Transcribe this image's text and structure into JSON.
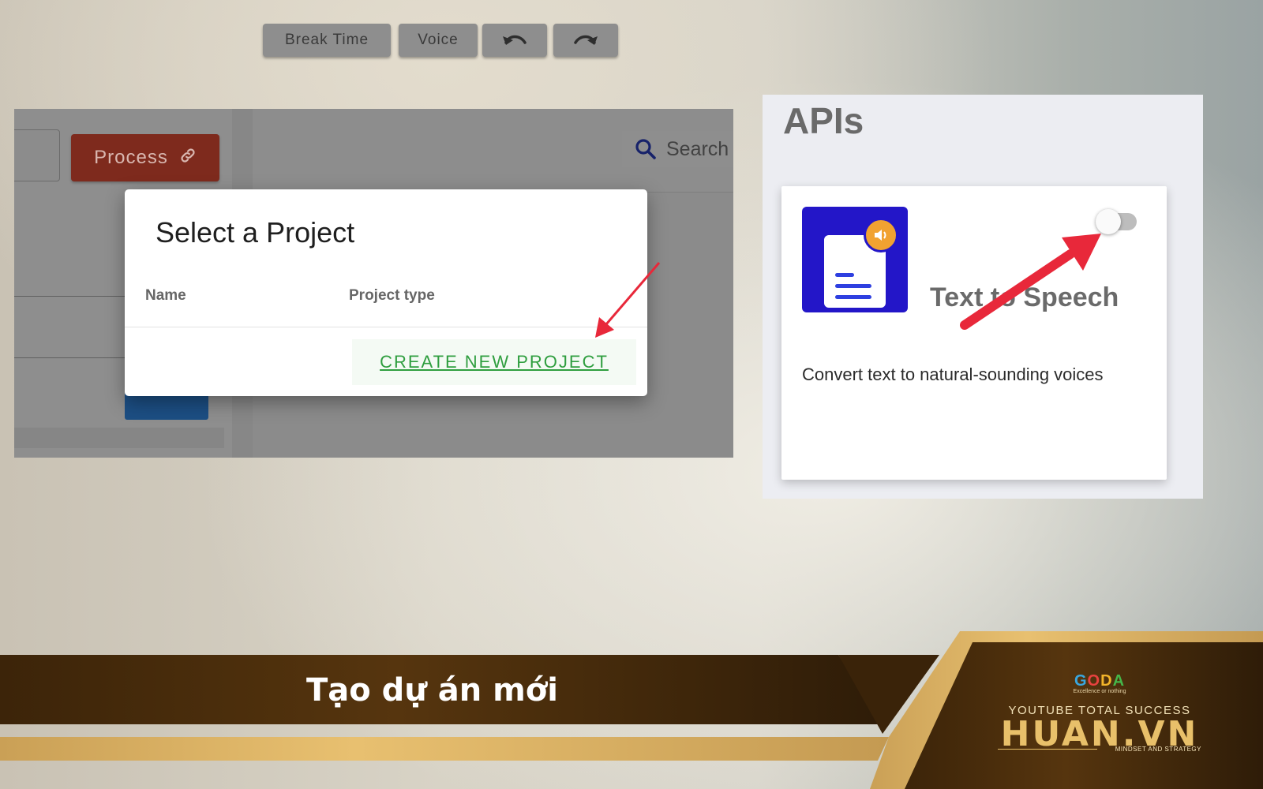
{
  "left_screenshot": {
    "process_button": {
      "label": "Process",
      "icon": "link-icon"
    },
    "toolbar": {
      "break_time": "Break Time",
      "voice": "Voice",
      "undo_icon": "undo-icon",
      "redo_icon": "redo-icon",
      "search_placeholder": "Search"
    },
    "dialog": {
      "title": "Select a Project",
      "columns": [
        "Name",
        "Project type"
      ],
      "create_button": "CREATE NEW PROJECT"
    }
  },
  "right_screenshot": {
    "section_title": "APIs",
    "card": {
      "name": "Text to Speech",
      "description": "Convert text to natural-sounding voices",
      "toggle_on": false,
      "icon": "text-to-speech-icon"
    }
  },
  "banner": {
    "caption": "Tạo dự án mới",
    "logo": {
      "goda_letters": [
        "G",
        "O",
        "D",
        "A"
      ],
      "goda_tagline": "Excellence or nothing",
      "tagline": "YOUTUBE TOTAL SUCCESS",
      "brand": "HUAN.VN",
      "subtitle": "MINDSET AND STRATEGY"
    }
  },
  "colors": {
    "banner_dark": "#3a2309",
    "gold": "#e4b863",
    "arrow_red": "#e8283a",
    "create_green": "#2f9e3f"
  }
}
